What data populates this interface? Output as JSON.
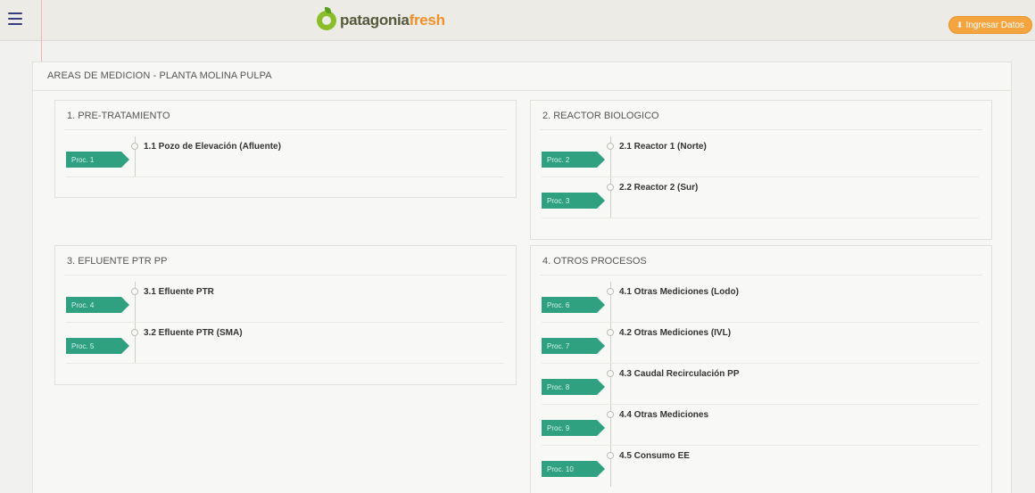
{
  "header": {
    "logo_text_a": "patagonia",
    "logo_text_b": "fresh",
    "ingresar_label": "Ingresar Datos"
  },
  "main": {
    "title": "AREAS DE MEDICION - PLANTA MOLINA PULPA"
  },
  "cards": [
    {
      "title": "1. PRE-TRATAMIENTO",
      "items": [
        {
          "tag": "Proc. 1",
          "label": "1.1 Pozo de Elevación (Afluente)"
        }
      ]
    },
    {
      "title": "2. REACTOR BIOLOGICO",
      "items": [
        {
          "tag": "Proc. 2",
          "label": "2.1 Reactor 1 (Norte)"
        },
        {
          "tag": "Proc. 3",
          "label": "2.2 Reactor 2 (Sur)"
        }
      ]
    },
    {
      "title": "3. EFLUENTE PTR PP",
      "items": [
        {
          "tag": "Proc. 4",
          "label": "3.1 Efluente PTR"
        },
        {
          "tag": "Proc. 5",
          "label": "3.2 Efluente PTR (SMA)"
        }
      ]
    },
    {
      "title": "4. OTROS PROCESOS",
      "items": [
        {
          "tag": "Proc. 6",
          "label": "4.1 Otras Mediciones (Lodo)"
        },
        {
          "tag": "Proc. 7",
          "label": "4.2 Otras Mediciones (IVL)"
        },
        {
          "tag": "Proc. 8",
          "label": "4.3 Caudal Recirculación PP"
        },
        {
          "tag": "Proc. 9",
          "label": "4.4 Otras Mediciones"
        },
        {
          "tag": "Proc. 10",
          "label": "4.5 Consumo EE"
        }
      ]
    }
  ]
}
